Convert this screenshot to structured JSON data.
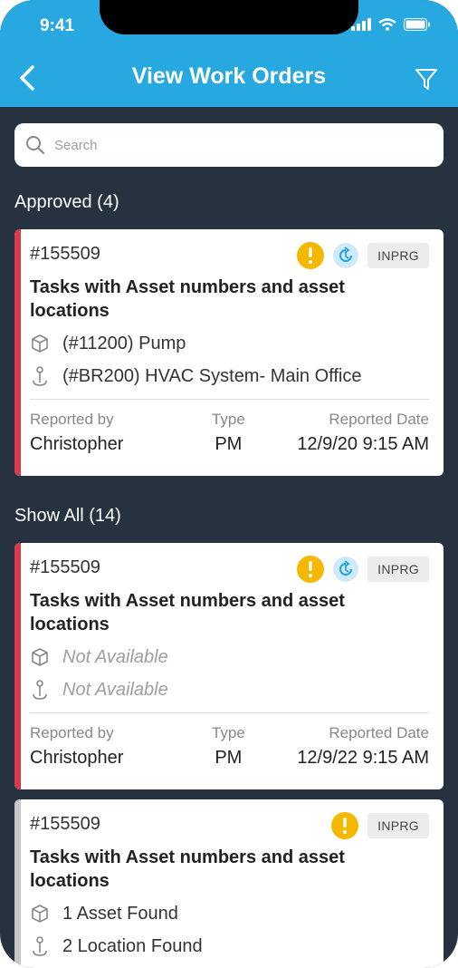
{
  "status_bar": {
    "time": "9:41"
  },
  "header": {
    "title": "View Work Orders"
  },
  "search": {
    "placeholder": "Search"
  },
  "sections": [
    {
      "title": "Approved (4)"
    },
    {
      "title": "Show All (14)"
    }
  ],
  "cards": [
    {
      "number": "#155509",
      "status": "INPRG",
      "title": "Tasks with Asset numbers and asset locations",
      "asset": "(#11200) Pump",
      "location": "(#BR200) HVAC System- Main Office",
      "reported_by_label": "Reported by",
      "reported_by": "Christopher",
      "type_label": "Type",
      "type": "PM",
      "date_label": "Reported Date",
      "date": "12/9/20 9:15 AM",
      "stripe_color": "#d93a4a"
    },
    {
      "number": "#155509",
      "status": "INPRG",
      "title": "Tasks with Asset numbers and asset locations",
      "asset": "Not Available",
      "location": "Not Available",
      "reported_by_label": "Reported by",
      "reported_by": "Christopher",
      "type_label": "Type",
      "type": "PM",
      "date_label": "Reported Date",
      "date": "12/9/22 9:15 AM",
      "stripe_color": "#d93a4a"
    },
    {
      "number": "#155509",
      "status": "INPRG",
      "title": "Tasks with Asset numbers and asset locations",
      "asset": "1 Asset Found",
      "location": "2 Location Found",
      "stripe_color": "#c8c8c8"
    }
  ],
  "colors": {
    "header_bg": "#28a8e0",
    "page_bg": "#263240",
    "warning": "#f5b800",
    "sync": "#29a8e0"
  },
  "icons": [
    "back-chevron-icon",
    "filter-icon",
    "search-icon",
    "warning-icon",
    "sync-icon",
    "asset-box-icon",
    "location-pin-icon"
  ]
}
